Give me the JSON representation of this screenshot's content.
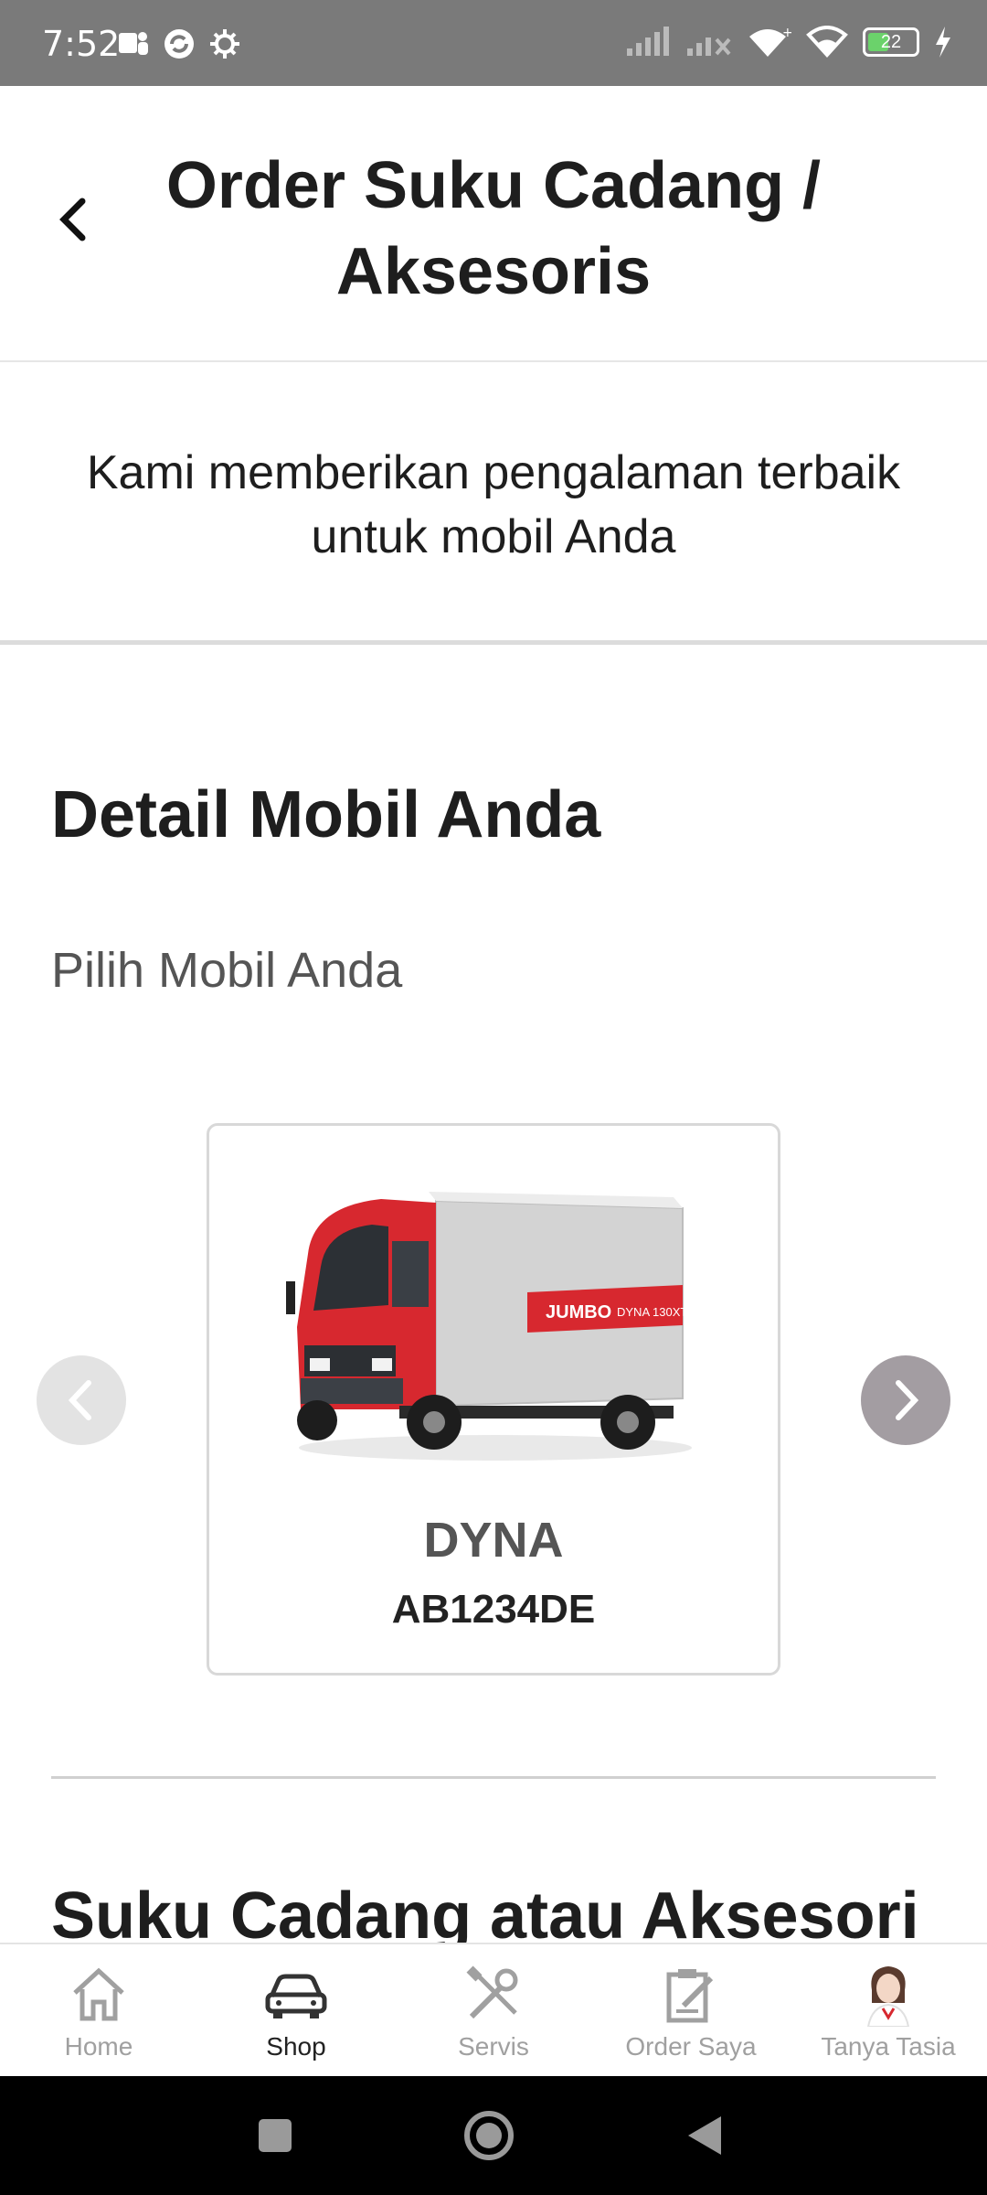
{
  "status_bar": {
    "time": "7:52",
    "battery_level": "22"
  },
  "header": {
    "title": "Order Suku Cadang / Aksesoris"
  },
  "tagline": "Kami memberikan pengalaman terbaik untuk mobil Anda",
  "car_section": {
    "title": "Detail Mobil Anda",
    "subtitle": "Pilih Mobil Anda",
    "selected_car": {
      "name": "DYNA",
      "plate": "AB1234DE",
      "image": "truck-image"
    }
  },
  "parts_section": {
    "title": "Suku Cadang atau Aksesori"
  },
  "bottom_nav": {
    "items": [
      {
        "label": "Home",
        "icon": "home-icon",
        "active": false
      },
      {
        "label": "Shop",
        "icon": "car-icon",
        "active": true
      },
      {
        "label": "Servis",
        "icon": "tools-icon",
        "active": false
      },
      {
        "label": "Order Saya",
        "icon": "order-icon",
        "active": false
      },
      {
        "label": "Tanya Tasia",
        "icon": "assistant-avatar-icon",
        "active": false
      }
    ]
  },
  "colors": {
    "accent_red": "#d7282f",
    "arrow_active": "#a39da2",
    "arrow_inactive": "#e3e3e3"
  }
}
